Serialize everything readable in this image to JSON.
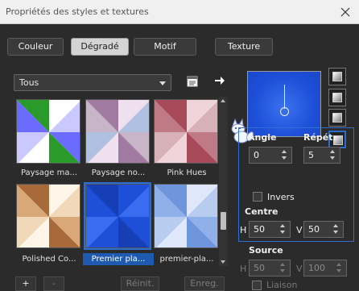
{
  "window": {
    "title": "Propriétés des styles et textures"
  },
  "tabs": [
    {
      "label": "Couleur",
      "active": false
    },
    {
      "label": "Dégradé",
      "active": true
    },
    {
      "label": "Motif",
      "active": false
    },
    {
      "label": "Texture",
      "active": false
    }
  ],
  "category_select": {
    "value": "Tous"
  },
  "icons": {
    "close": "close-icon",
    "library": "gradient-library-icon",
    "arrow": "arrow-right-icon",
    "fox": "fox-mascot-icon"
  },
  "gradients": [
    {
      "label": "Paysage ma...",
      "selected": false
    },
    {
      "label": "Paysage no...",
      "selected": false
    },
    {
      "label": "Pink Hues",
      "selected": false
    },
    {
      "label": "Polished Co...",
      "selected": false
    },
    {
      "label": "Premier pla...",
      "selected": true
    },
    {
      "label": "premier-pla...",
      "selected": false
    }
  ],
  "params": {
    "angle_label": "Angle",
    "repeat_label": "Répét.",
    "angle_value": "0",
    "repeat_value": "5",
    "invert_label": "Invers",
    "center_label": "Centre",
    "h_label": "H",
    "v_label": "V",
    "center_h": "50",
    "center_v": "50",
    "source_label": "Source",
    "source_h": "50",
    "source_v": "100",
    "link_label": "Liaison"
  },
  "bottom": {
    "add": "+",
    "remove": "-",
    "reset": "Réinit.",
    "save": "Enreg."
  },
  "colors": {
    "accent": "#2a6fcf",
    "panel": "#2b2b2b",
    "gradient_blue": "#1d4fd8"
  }
}
